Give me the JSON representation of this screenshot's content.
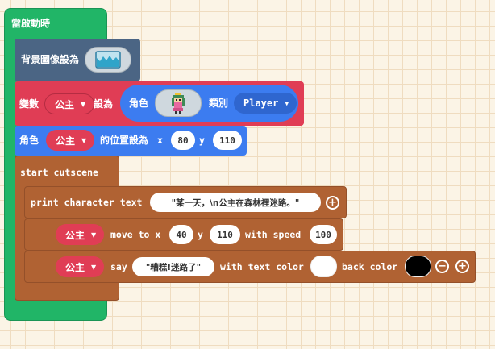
{
  "hat": {
    "label": "當啟動時"
  },
  "set_background": {
    "label": "背景圖像設為",
    "image_icon": "landscape-image-icon"
  },
  "set_variable": {
    "prefix": "變數",
    "variable": "公主",
    "set_to": "設為",
    "sprite_label": "角色",
    "sprite_icon": "princess-pixel-sprite-icon",
    "kind_label": "類別",
    "kind": "Player"
  },
  "set_position": {
    "prefix": "角色",
    "sprite": "公主",
    "middle": "的位置設為",
    "x_label": "x",
    "x": "80",
    "y_label": "y",
    "y": "110"
  },
  "cutscene": {
    "label": "start cutscene",
    "print": {
      "label": "print character text",
      "text": "\"某一天，\\n公主在森林裡迷路。\""
    },
    "move": {
      "sprite": "公主",
      "label": "move to x",
      "x": "40",
      "y_label": "y",
      "y": "110",
      "speed_label": "with speed",
      "speed": "100"
    },
    "say": {
      "sprite": "公主",
      "label": "say",
      "text": "\"糟糕!迷路了\"",
      "text_color_label": "with text color",
      "text_color": "#ffffff",
      "back_color_label": "back color",
      "back_color": "#000000"
    }
  },
  "colors": {
    "event_green": "#21b567",
    "scene_slate": "#4b6584",
    "variable_red": "#e03d55",
    "sprite_blue": "#3c7cf0",
    "cutscene_brown": "#b06233"
  }
}
